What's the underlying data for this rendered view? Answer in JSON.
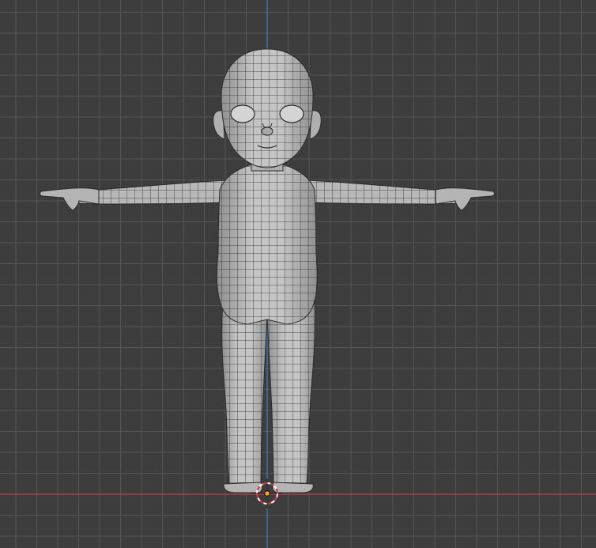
{
  "viewport": {
    "view": "front-orthographic",
    "mode": "edit-mesh",
    "overlays": [
      "wireframe",
      "grid-floor",
      "3d-cursor",
      "origin"
    ],
    "colors": {
      "background": "#3d3d3d",
      "grid_minor": "#474747",
      "grid_major": "#555555",
      "axis_x": "#b8434f",
      "axis_z": "#4a78b0",
      "mesh_fill": "#b4b4b4",
      "mesh_shade": "#8f8f8f",
      "wire": "#2a2a2a",
      "cursor_ring_red": "#e0313d",
      "cursor_ring_white": "#ffffff",
      "origin_dot": "#f5a623"
    }
  },
  "object": {
    "type": "mesh",
    "icon": "person-icon",
    "pose": "T-pose"
  }
}
